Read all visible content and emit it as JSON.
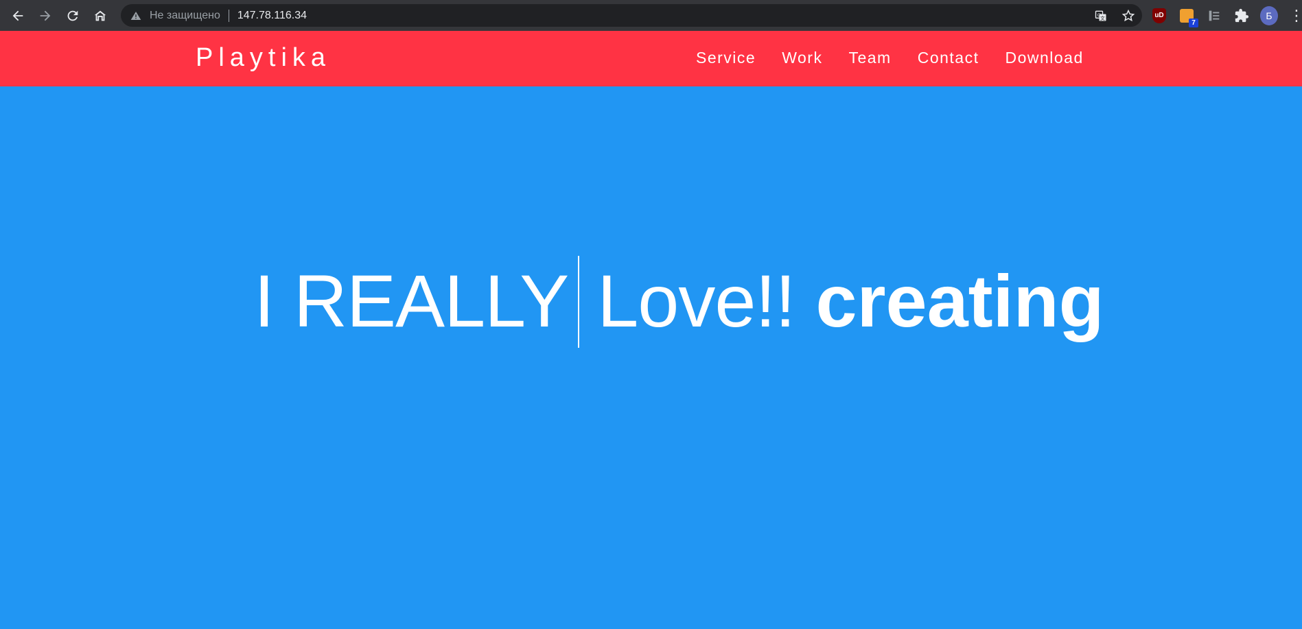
{
  "browser": {
    "security_label": "Не защищено",
    "url": "147.78.116.34",
    "extension_badge": "7",
    "avatar_letter": "Б",
    "icons": [
      "back-icon",
      "forward-icon",
      "reload-icon",
      "home-icon",
      "warning-icon",
      "translate-icon",
      "star-icon",
      "ublock-icon",
      "rss-icon",
      "tab-search-icon",
      "puzzle-icon",
      "menu-icon"
    ]
  },
  "site": {
    "brand": "Playtika",
    "nav": [
      "Service",
      "Work",
      "Team",
      "Contact",
      "Download"
    ],
    "colors": {
      "header": "#ff3344",
      "hero": "#2196f3"
    }
  },
  "hero": {
    "thin_text": "I REALLY",
    "thin_text_2": "Love!!",
    "bold_text": "creating"
  }
}
